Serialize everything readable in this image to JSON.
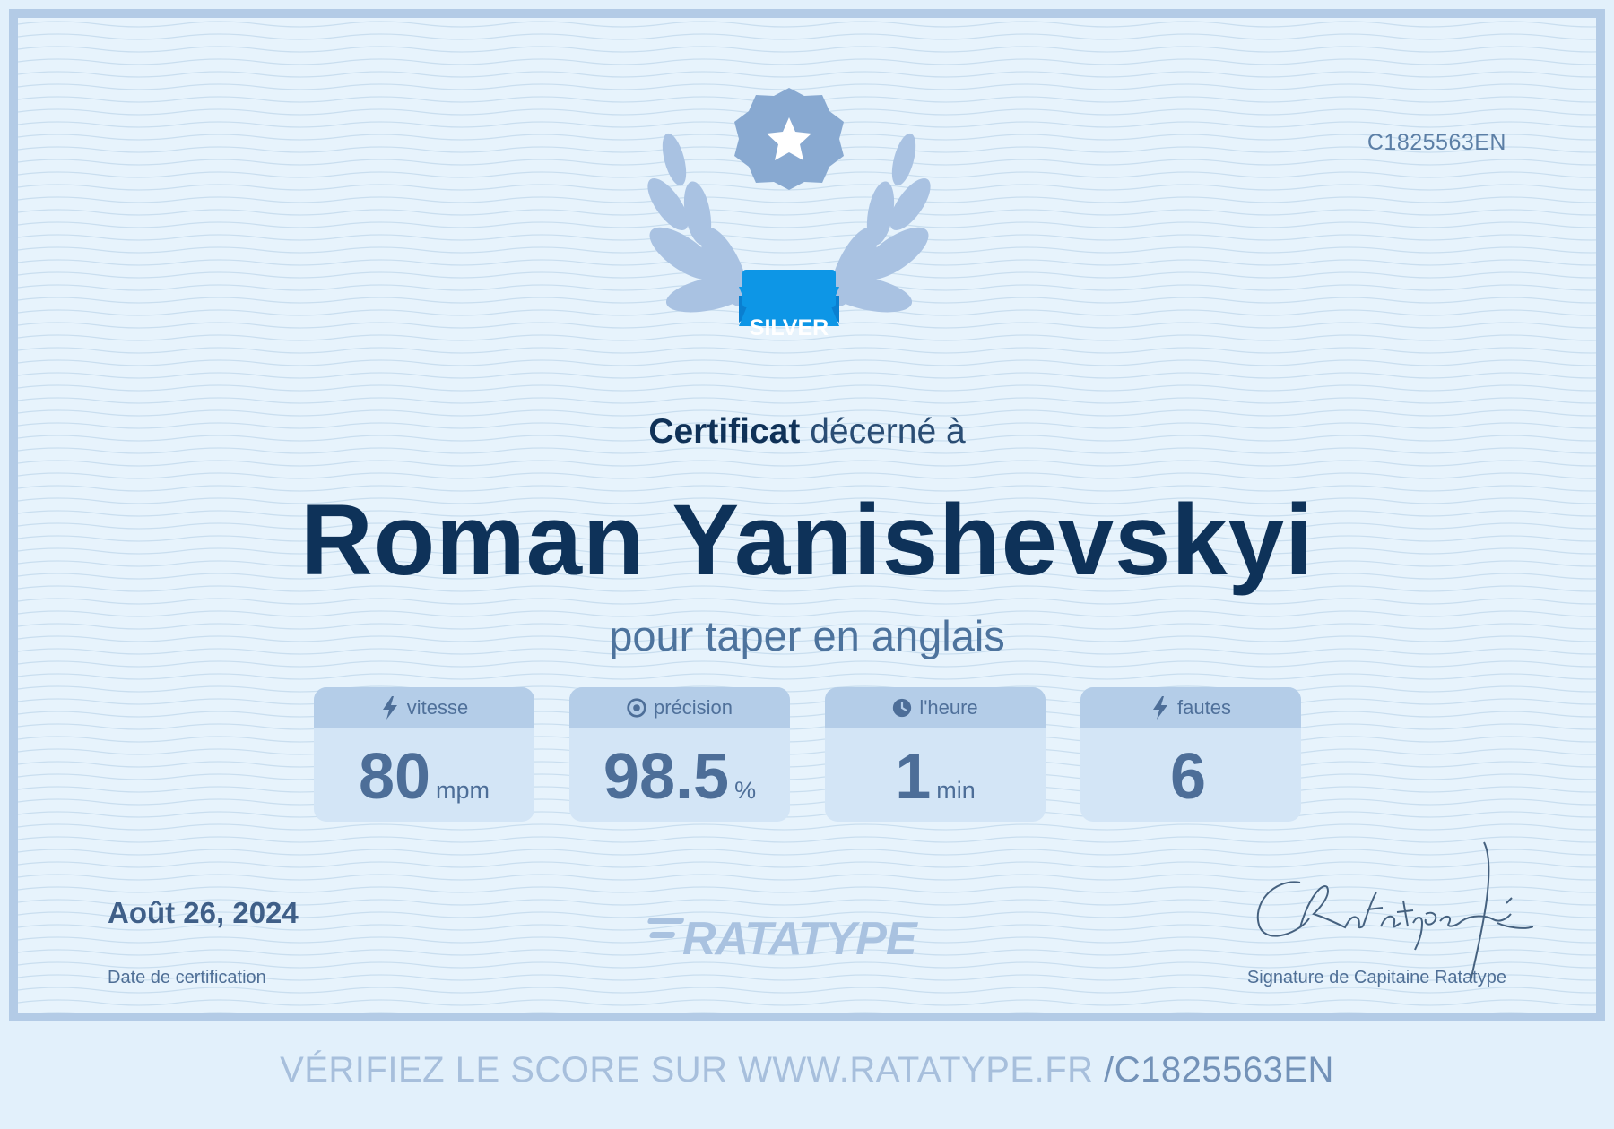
{
  "certificate": {
    "id": "C1825563EN",
    "badge": "SILVER",
    "headline_strong": "Certificat",
    "headline_rest": " décerné à",
    "recipient": "Roman Yanishevskyi",
    "subtitle": "pour taper en anglais",
    "stats": [
      {
        "label": "vitesse",
        "icon": "lightning-icon",
        "value": "80",
        "unit": "mpm"
      },
      {
        "label": "précision",
        "icon": "target-icon",
        "value": "98.5",
        "unit": "%"
      },
      {
        "label": "l'heure",
        "icon": "clock-icon",
        "value": "1",
        "unit": "min"
      },
      {
        "label": "fautes",
        "icon": "lightning-icon",
        "value": "6",
        "unit": ""
      }
    ],
    "date": "Août 26, 2024",
    "date_label": "Date de certification",
    "brand": "RATATYPE",
    "signature_text": "CRatatype fé",
    "signature_label": "Signature de Capitaine Ratatype"
  },
  "footer": {
    "verify_text": "VÉRIFIEZ LE SCORE SUR WWW.RATATYPE.FR",
    "verify_code": "/C1825563EN"
  },
  "colors": {
    "page_bg": "#e2f0fb",
    "frame_border": "#b3cbe6",
    "title_navy": "#0e3259",
    "badge_blue": "#0d96e6",
    "stat_value": "#4d6e98"
  }
}
